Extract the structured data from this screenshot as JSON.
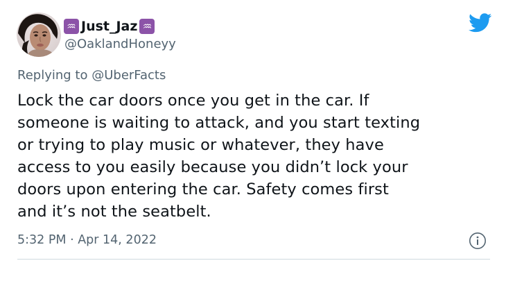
{
  "tweet": {
    "display_name": "Just_Jaz",
    "name_emoji": "aquarius-emoji",
    "handle": "@OaklandHoneyy",
    "replying_prefix": "Replying to",
    "replying_to": "@UberFacts",
    "body_lines": [
      "Lock the car doors once you get in the car. If",
      "someone is waiting to attack, and you start texting",
      "or trying to play music or whatever, they have",
      "access to you easily because you didn’t lock your",
      "doors upon entering the car. Safety comes first",
      "and it’s not the seatbelt."
    ],
    "timestamp": "5:32 PM · Apr 14, 2022",
    "icons": {
      "platform": "twitter-bird-icon",
      "info": "info-icon"
    },
    "colors": {
      "brand": "#1d9bf0",
      "secondary_text": "#536471",
      "primary_text": "#0f1419",
      "emoji_bg": "#8c53a8"
    }
  }
}
